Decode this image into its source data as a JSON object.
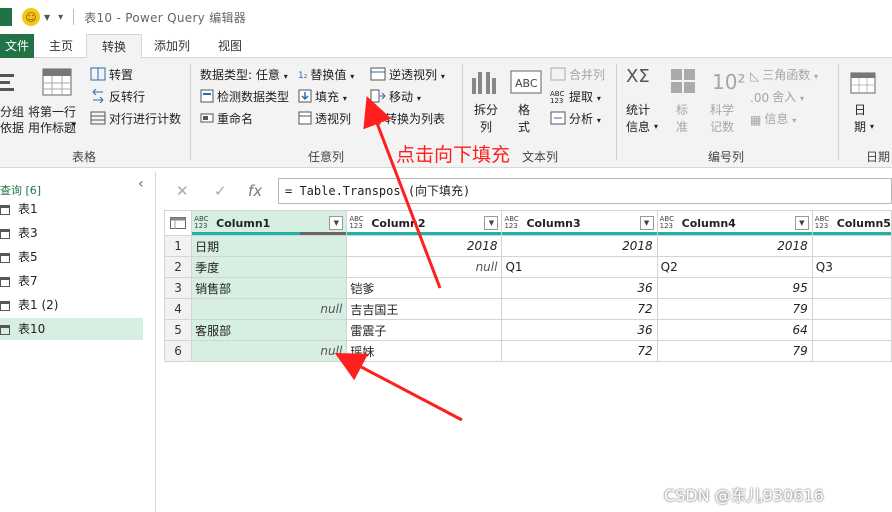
{
  "window": {
    "title": "表10 - Power Query 编辑器"
  },
  "tabs": [
    {
      "label": "文件"
    },
    {
      "label": "主页"
    },
    {
      "label": "转换"
    },
    {
      "label": "添加列"
    },
    {
      "label": "视图"
    }
  ],
  "ribbon": {
    "table_group": {
      "label": "表格",
      "group_by": "分组\n依据",
      "first_row_header": "将第一行\n用作标题",
      "transpose": "转置",
      "reverse_rows": "反转行",
      "count_rows": "对行进行计数"
    },
    "any_column_group": {
      "label": "任意列",
      "data_type": "数据类型: 任意",
      "detect_type": "检测数据类型",
      "rename": "重命名",
      "replace_values": "替换值",
      "fill": "填充",
      "pivot_column": "透视列",
      "unpivot": "逆透视列",
      "move": "移动",
      "to_list": "转换为列表"
    },
    "text_group": {
      "label": "文本列",
      "split": "拆分\n列",
      "format": "格\n式",
      "merge": "合并列",
      "extract": "提取",
      "parse": "分析"
    },
    "number_group": {
      "label": "编号列",
      "statistics": "统计\n信息",
      "standard": "标\n准",
      "scientific": "科学\n记数",
      "trig": "三角函数",
      "rounding": "舍入",
      "information": "信息"
    },
    "date_group": {
      "label": "日期",
      "date": "日\n期"
    }
  },
  "formula_bar": {
    "text": "= Table.Transpos (向下填充)"
  },
  "queries": {
    "header": "查询 [6]",
    "items": [
      "表1",
      "表3",
      "表5",
      "表7",
      "表1 (2)",
      "表10"
    ],
    "selected": "表10"
  },
  "grid": {
    "type_label": "ABC\n123",
    "columns": [
      "Column1",
      "Column2",
      "Column3",
      "Column4",
      "Column5"
    ],
    "rows": [
      {
        "n": "1",
        "c1": "日期",
        "c2": "2018",
        "c3": "2018",
        "c4": "2018",
        "c5": ""
      },
      {
        "n": "2",
        "c1": "季度",
        "c2": "null",
        "c3": "Q1",
        "c4": "Q2",
        "c5": "Q3"
      },
      {
        "n": "3",
        "c1": "销售部",
        "c2": "铠爹",
        "c3": "36",
        "c4": "95",
        "c5": ""
      },
      {
        "n": "4",
        "c1": "null",
        "c2": "吉吉国王",
        "c3": "72",
        "c4": "79",
        "c5": ""
      },
      {
        "n": "5",
        "c1": "客服部",
        "c2": "雷震子",
        "c3": "36",
        "c4": "64",
        "c5": ""
      },
      {
        "n": "6",
        "c1": "null",
        "c2": "瑶妹",
        "c3": "72",
        "c4": "79",
        "c5": ""
      }
    ]
  },
  "annotation": {
    "text": "点击向下填充",
    "color": "#ff1f1f"
  },
  "watermark": {
    "text": "CSDN @东儿930616"
  },
  "colors": {
    "accent": "#217346",
    "selection": "#d7eee3",
    "quality_bar": "#1cb3a5"
  }
}
